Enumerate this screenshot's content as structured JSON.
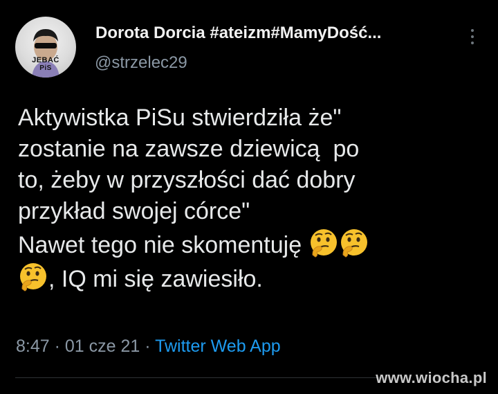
{
  "author": {
    "display_name": "Dorota Dorcia #ateizm#MamyDość...",
    "handle": "@strzelec29",
    "avatar": {
      "line1": "JEBAĆ",
      "line2": "PiS"
    }
  },
  "menu_icon": "more-vertical-icon",
  "tweet": {
    "lines": [
      "Aktywistka PiSu stwierdziła że\"",
      "zostanie na zawsze dziewicą  po",
      "to, żeby w przyszłości dać dobry",
      "przykład swojej córce\"",
      "Nawet tego nie skomentuję",
      ", IQ mi się zawiesiło."
    ],
    "emoji": "thinking-face-icon"
  },
  "meta": {
    "time": "8:47",
    "separator": " · ",
    "date": "01 cze 21",
    "app": "Twitter Web App"
  },
  "watermark": "www.wiocha.pl",
  "colors": {
    "background": "#000000",
    "text": "#e7e9ea",
    "secondary": "#8b98a5",
    "link": "#1d9bf0"
  }
}
